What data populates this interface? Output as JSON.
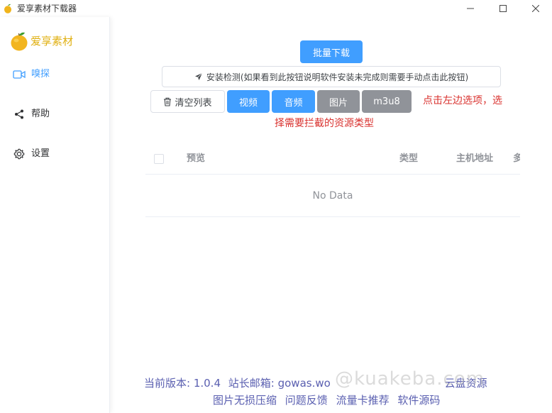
{
  "window": {
    "title": "爱享素材下载器",
    "controls": {
      "minimize": "minimize-icon",
      "maximize": "maximize-icon",
      "close": "close-icon"
    }
  },
  "sidebar": {
    "brand": "爱享素材",
    "items": [
      {
        "label": "嗅探",
        "icon": "video-icon",
        "active": true
      },
      {
        "label": "帮助",
        "icon": "share-icon",
        "active": false
      },
      {
        "label": "设置",
        "icon": "gear-icon",
        "active": false
      }
    ]
  },
  "toolbar": {
    "batch_download": "批量下载",
    "install_check": "安装检测(如果看到此按钮说明软件安装未完成则需要手动点击此按钮)",
    "clear_list": "清空列表",
    "filters": [
      {
        "label": "视频",
        "selected": true
      },
      {
        "label": "音频",
        "selected": true
      },
      {
        "label": "图片",
        "selected": false
      },
      {
        "label": "m3u8",
        "selected": false
      }
    ],
    "hint_line1": "点击左边选项，选",
    "hint_line2": "择需要拦截的资源类型"
  },
  "table": {
    "columns": [
      "预览",
      "类型",
      "主机地址",
      "多"
    ],
    "rows": [],
    "empty_text": "No Data"
  },
  "footer": {
    "line1": [
      "当前版本: 1.0.4",
      "站长邮箱: gowas.wo",
      "云盘资源"
    ],
    "line2": [
      "图片无损压缩",
      "问题反馈",
      "流量卡推荐",
      "软件源码"
    ]
  },
  "watermark": "@kuakeba.com",
  "colors": {
    "primary": "#409eff",
    "info": "#909399",
    "hint": "#d9312e",
    "brand": "#e0b012",
    "footer_link": "#5a5fb0"
  }
}
